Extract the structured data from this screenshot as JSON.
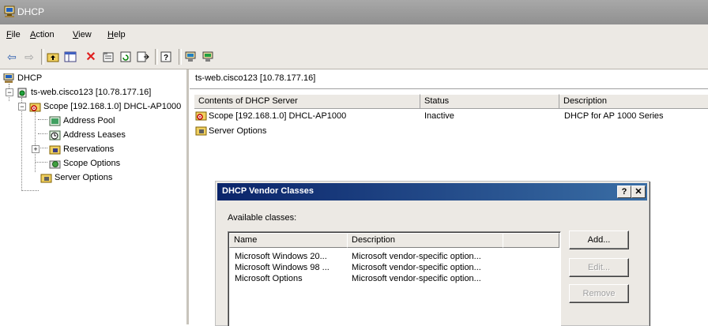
{
  "window": {
    "title": "DHCP"
  },
  "menu": [
    {
      "label": "File",
      "accel": "F",
      "rest": "ile"
    },
    {
      "label": "Action",
      "accel": "A",
      "rest": "ction"
    },
    {
      "label": "View",
      "accel": "V",
      "rest": "iew"
    },
    {
      "label": "Help",
      "accel": "H",
      "rest": "elp"
    }
  ],
  "toolbar": [
    "back-icon",
    "forward-icon",
    "up-folder-icon",
    "show-hide-tree-icon",
    "delete-icon",
    "properties-icon",
    "refresh-icon",
    "export-list-icon",
    "help-icon",
    "server-icon",
    "add-server-icon"
  ],
  "tree": {
    "root": "DHCP",
    "server": "ts-web.cisco123 [10.78.177.16]",
    "scope": "Scope [192.168.1.0] DHCL-AP1000",
    "address_pool": "Address Pool",
    "address_leases": "Address Leases",
    "reservations": "Reservations",
    "scope_options": "Scope Options",
    "server_options": "Server Options"
  },
  "content": {
    "header": "ts-web.cisco123 [10.78.177.16]",
    "columns": [
      "Contents of DHCP Server",
      "Status",
      "Description"
    ],
    "rows": [
      {
        "name": "Scope [192.168.1.0] DHCL-AP1000",
        "status": "Inactive",
        "description": "DHCP for AP 1000 Series"
      },
      {
        "name": "Server Options",
        "status": "",
        "description": ""
      }
    ]
  },
  "dialog": {
    "title": "DHCP Vendor Classes",
    "help_btn": "?",
    "close_btn": "✕",
    "available_label": "Available classes:",
    "columns": [
      "Name",
      "Description"
    ],
    "rows": [
      {
        "name": "Microsoft Windows 20...",
        "description": "Microsoft vendor-specific option..."
      },
      {
        "name": "Microsoft Windows 98 ...",
        "description": "Microsoft vendor-specific option..."
      },
      {
        "name": "Microsoft Options",
        "description": "Microsoft vendor-specific option..."
      }
    ],
    "buttons": {
      "add": "Add...",
      "edit": "Edit...",
      "remove": "Remove"
    }
  }
}
